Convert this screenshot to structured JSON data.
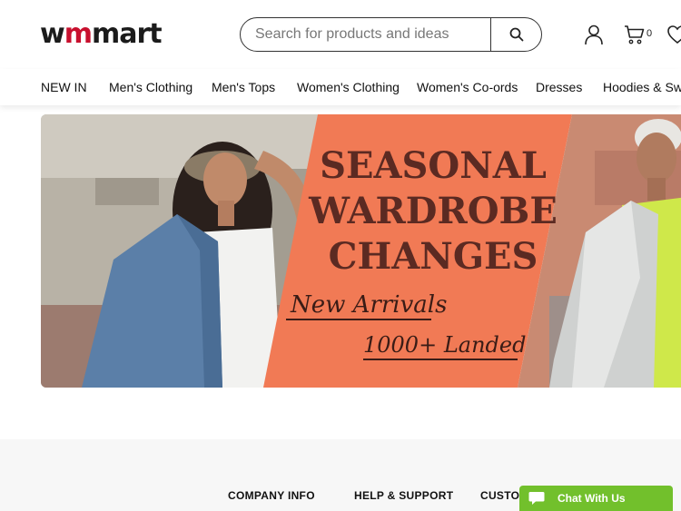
{
  "header": {
    "logo_main": "wmmart",
    "search": {
      "placeholder": "Search for products and ideas"
    },
    "cart_count": "0"
  },
  "nav": {
    "items": [
      {
        "label": "NEW IN"
      },
      {
        "label": "Men's Clothing"
      },
      {
        "label": "Men's Tops"
      },
      {
        "label": "Women's Clothing"
      },
      {
        "label": "Women's Co-ords"
      },
      {
        "label": "Dresses"
      },
      {
        "label": "Hoodies & Swe"
      }
    ]
  },
  "banner": {
    "line1": "SEASONAL",
    "line2": "WARDROBE",
    "line3": "CHANGES",
    "script1": "New Arrivals",
    "script2": "1000+ Landed",
    "colors": {
      "orange": "#f17a55",
      "text": "#5b2a22"
    }
  },
  "footer": {
    "headings": [
      {
        "label": "COMPANY INFO"
      },
      {
        "label": "HELP & SUPPORT"
      },
      {
        "label": "CUSTOMER CARE"
      }
    ]
  },
  "chat": {
    "label": "Chat With Us",
    "color": "#72c02c"
  },
  "icons": [
    "search-icon",
    "user-icon",
    "cart-icon",
    "heart-icon",
    "chat-icon"
  ]
}
